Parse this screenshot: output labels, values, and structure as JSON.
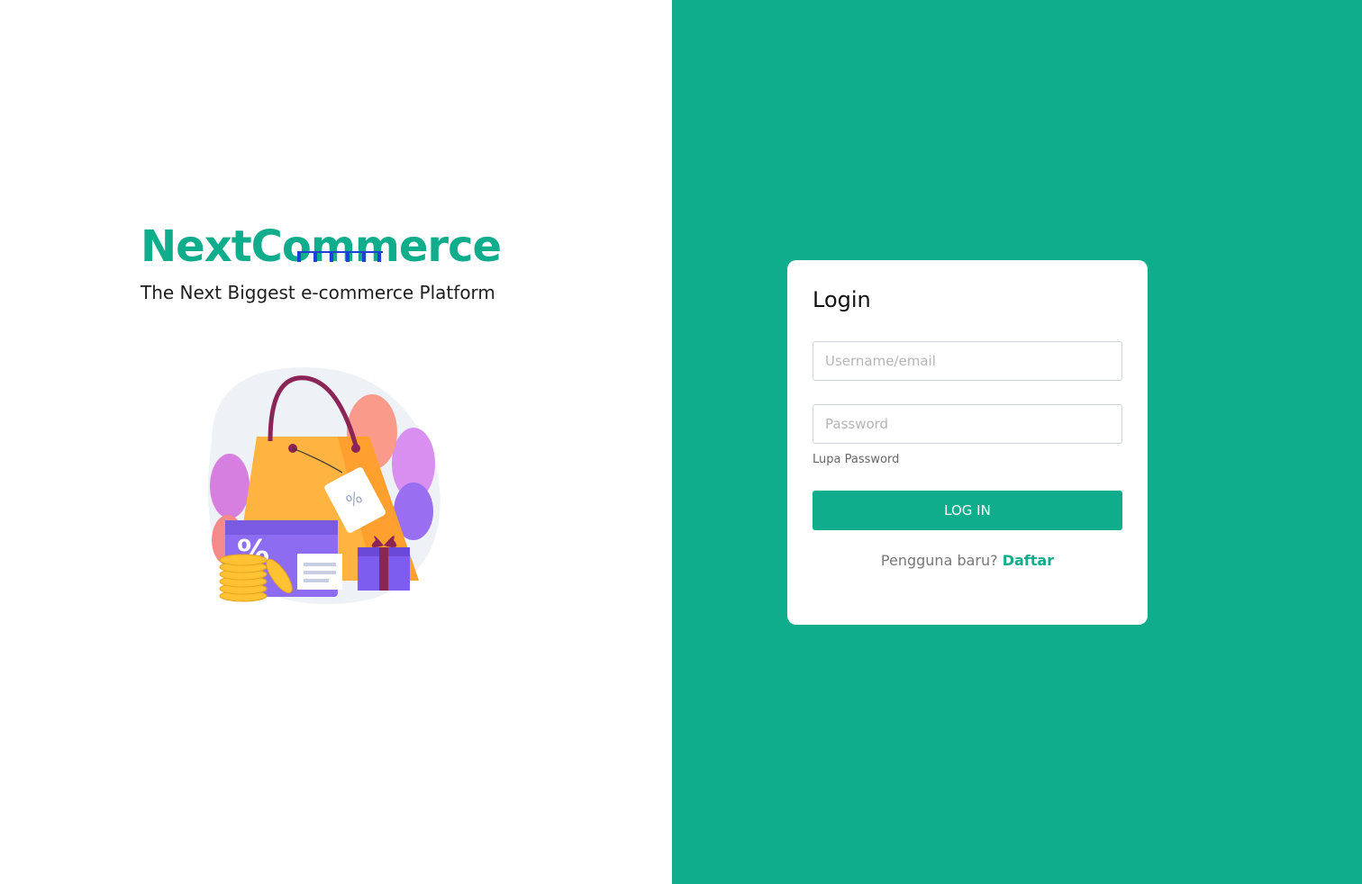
{
  "brand": {
    "title": "NextCommerce",
    "tagline": "The Next Biggest e-commerce Platform",
    "color": "#10ad8c",
    "underline_color": "#1f3fd6"
  },
  "illustration": {
    "icon": "shopping-bag-illustration",
    "tag_text": "%",
    "coupon_text": "%"
  },
  "login": {
    "title": "Login",
    "username_placeholder": "Username/email",
    "password_placeholder": "Password",
    "forgot_label": "Lupa Password",
    "submit_label": "LOG IN",
    "signup_prompt": "Pengguna baru?",
    "signup_link": "Daftar"
  },
  "colors": {
    "accent": "#10ad8c",
    "panel_background": "#10ad8c",
    "card_background": "#ffffff"
  }
}
